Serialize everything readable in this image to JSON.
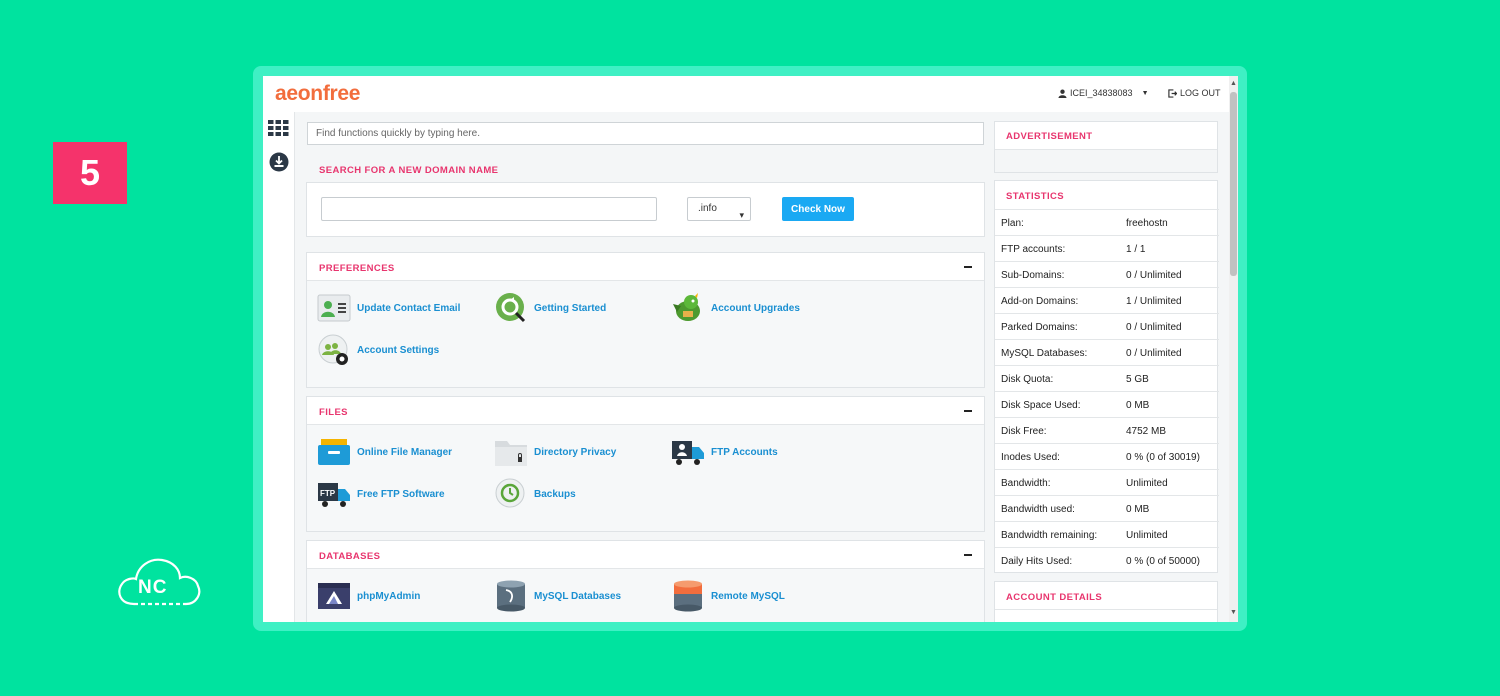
{
  "step_number": "5",
  "watermark": {
    "text": "NC"
  },
  "brand": {
    "name": "aeonfree",
    "color": "#f26d3d"
  },
  "header": {
    "username": "ICEI_34838083",
    "logout_label": "LOG OUT"
  },
  "search": {
    "placeholder": "Find functions quickly by typing here."
  },
  "domain_search": {
    "title": "SEARCH FOR A NEW DOMAIN NAME",
    "input_value": "",
    "tld_selected": ".info",
    "button_label": "Check Now"
  },
  "preferences": {
    "title": "PREFERENCES",
    "items": [
      {
        "label": "Update Contact Email",
        "icon": "contact-card-icon"
      },
      {
        "label": "Getting Started",
        "icon": "getting-started-icon"
      },
      {
        "label": "Account Upgrades",
        "icon": "dragon-icon"
      },
      {
        "label": "Account Settings",
        "icon": "users-gear-icon"
      }
    ]
  },
  "files": {
    "title": "FILES",
    "items": [
      {
        "label": "Online File Manager",
        "icon": "file-cabinet-icon"
      },
      {
        "label": "Directory Privacy",
        "icon": "folder-lock-icon"
      },
      {
        "label": "FTP Accounts",
        "icon": "ftp-user-truck-icon"
      },
      {
        "label": "Free FTP Software",
        "icon": "ftp-truck-icon"
      },
      {
        "label": "Backups",
        "icon": "backup-icon"
      }
    ]
  },
  "databases": {
    "title": "DATABASES",
    "items": [
      {
        "label": "phpMyAdmin",
        "icon": "phpmyadmin-icon"
      },
      {
        "label": "MySQL Databases",
        "icon": "mysql-database-icon"
      },
      {
        "label": "Remote MySQL",
        "icon": "remote-mysql-icon"
      }
    ]
  },
  "advertisement": {
    "title": "ADVERTISEMENT"
  },
  "statistics": {
    "title": "STATISTICS",
    "rows": [
      {
        "key": "Plan:",
        "value": "freehostn"
      },
      {
        "key": "FTP accounts:",
        "value": "1 / 1"
      },
      {
        "key": "Sub-Domains:",
        "value": "0 / Unlimited"
      },
      {
        "key": "Add-on Domains:",
        "value": "1 / Unlimited"
      },
      {
        "key": "Parked Domains:",
        "value": "0 / Unlimited"
      },
      {
        "key": "MySQL Databases:",
        "value": "0 / Unlimited"
      },
      {
        "key": "Disk Quota:",
        "value": "5 GB"
      },
      {
        "key": "Disk Space Used:",
        "value": "0 MB"
      },
      {
        "key": "Disk Free:",
        "value": "4752 MB"
      },
      {
        "key": "Inodes Used:",
        "value": "0 % (0 of 30019)"
      },
      {
        "key": "Bandwidth:",
        "value": "Unlimited"
      },
      {
        "key": "Bandwidth used:",
        "value": "0 MB"
      },
      {
        "key": "Bandwidth remaining:",
        "value": "Unlimited"
      },
      {
        "key": "Daily Hits Used:",
        "value": "0 % (0 of 50000)"
      }
    ]
  },
  "account_details": {
    "title": "ACCOUNT DETAILS"
  },
  "colors": {
    "background": "#00e39f",
    "accent": "#e8356e",
    "link": "#1a8fd1",
    "button": "#1aa9f3",
    "badge": "#f5336b"
  }
}
